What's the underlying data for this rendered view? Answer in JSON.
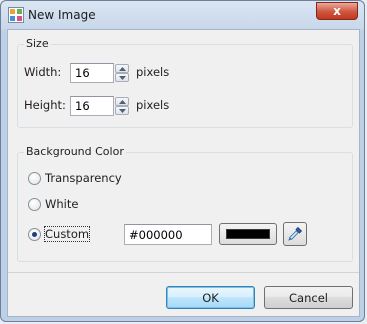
{
  "window": {
    "title": "New Image",
    "close_label": "x"
  },
  "size_group": {
    "title": "Size",
    "width_label": "Width:",
    "width_value": "16",
    "width_unit": "pixels",
    "height_label": "Height:",
    "height_value": "16",
    "height_unit": "pixels"
  },
  "background_group": {
    "title": "Background Color",
    "options": [
      {
        "label": "Transparency",
        "selected": false
      },
      {
        "label": "White",
        "selected": false
      },
      {
        "label": "Custom",
        "selected": true
      }
    ],
    "custom_hex": "#000000",
    "swatch_color": "#000000",
    "picker_icon": "eyedropper-icon"
  },
  "buttons": {
    "ok_label": "OK",
    "cancel_label": "Cancel"
  },
  "colors": {
    "accent": "#3c7fb1",
    "close_red": "#c1391f"
  }
}
